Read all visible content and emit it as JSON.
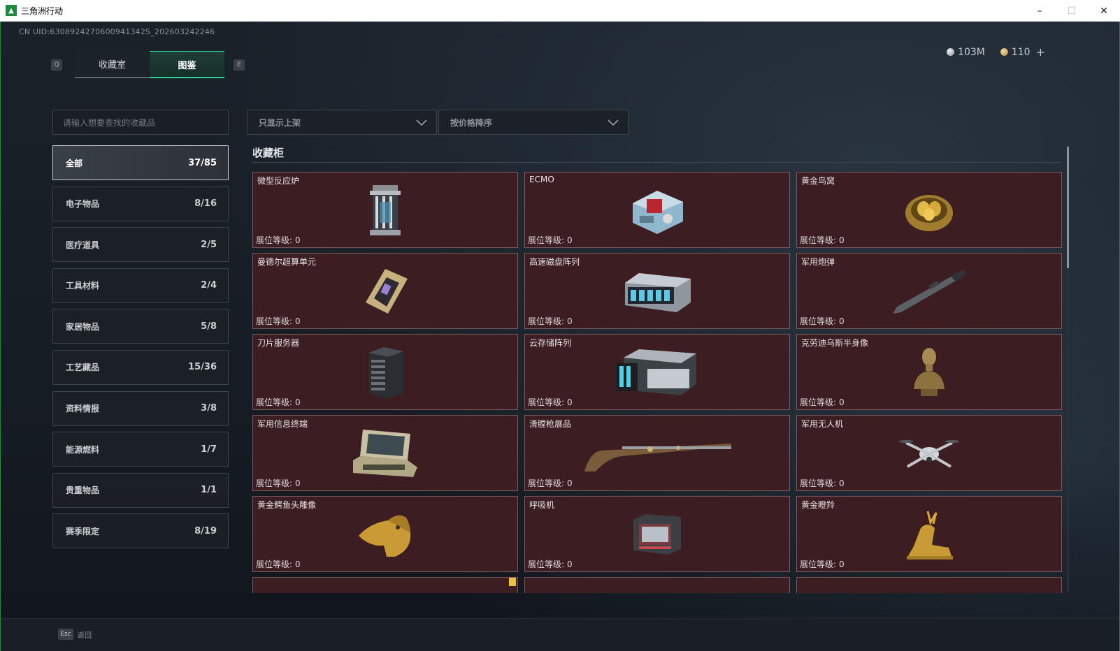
{
  "window": {
    "title": "三角洲行动",
    "controls": [
      "–",
      "☐",
      "✕"
    ]
  },
  "header": {
    "uid": "CN UID:6308924270600941342S_202603242246",
    "currency": [
      {
        "value": "103M",
        "icon": "silver-coin-icon"
      },
      {
        "value": "110",
        "icon": "gold-coin-icon"
      }
    ],
    "currency_add": "+"
  },
  "tabs": {
    "prev_key": "Q",
    "next_key": "E",
    "items": [
      {
        "label": "收藏室",
        "active": false
      },
      {
        "label": "图鉴",
        "active": true
      }
    ]
  },
  "search": {
    "placeholder": "请输入想要查找的收藏品"
  },
  "categories": [
    {
      "label": "全部",
      "count": "37/85",
      "active": true
    },
    {
      "label": "电子物品",
      "count": "8/16"
    },
    {
      "label": "医疗道具",
      "count": "2/5"
    },
    {
      "label": "工具材料",
      "count": "2/4"
    },
    {
      "label": "家居物品",
      "count": "5/8"
    },
    {
      "label": "工艺藏品",
      "count": "15/36"
    },
    {
      "label": "资料情报",
      "count": "3/8"
    },
    {
      "label": "能源燃料",
      "count": "1/7"
    },
    {
      "label": "贵重物品",
      "count": "1/1"
    },
    {
      "label": "赛季限定",
      "count": "8/19"
    }
  ],
  "filters": {
    "show_filter": "只显示上架",
    "sort": "按价格降序"
  },
  "section": {
    "title": "收藏柜"
  },
  "level_label": "展位等级:",
  "items": [
    {
      "name": "微型反应炉",
      "level": "0",
      "icon": "reactor-icon"
    },
    {
      "name": "ECMO",
      "level": "0",
      "icon": "ecmo-icon"
    },
    {
      "name": "黄金鸟窝",
      "level": "0",
      "icon": "golden-nest-icon"
    },
    {
      "name": "曼德尔超算单元",
      "level": "0",
      "icon": "supercomputer-unit-icon"
    },
    {
      "name": "高速磁盘阵列",
      "level": "0",
      "icon": "disk-array-icon"
    },
    {
      "name": "军用炮弹",
      "level": "0",
      "icon": "artillery-shell-icon"
    },
    {
      "name": "刀片服务器",
      "level": "0",
      "icon": "blade-server-icon"
    },
    {
      "name": "云存储阵列",
      "level": "0",
      "icon": "cloud-storage-icon"
    },
    {
      "name": "克劳迪乌斯半身像",
      "level": "0",
      "icon": "bust-icon"
    },
    {
      "name": "军用信息终端",
      "level": "0",
      "icon": "military-terminal-icon"
    },
    {
      "name": "滑膛枪展品",
      "level": "0",
      "icon": "musket-icon"
    },
    {
      "name": "军用无人机",
      "level": "0",
      "icon": "drone-icon"
    },
    {
      "name": "黄金鳄鱼头雕像",
      "level": "0",
      "icon": "golden-crocodile-icon"
    },
    {
      "name": "呼吸机",
      "level": "0",
      "icon": "ventilator-icon"
    },
    {
      "name": "黄金瞪羚",
      "level": "0",
      "icon": "golden-gazelle-icon"
    }
  ],
  "bottom": {
    "esc_key": "Esc",
    "esc_label": "返回"
  },
  "colors": {
    "accent": "#2ad49c",
    "card_bg": "#3c1d22",
    "card_border": "#7b5a5e"
  }
}
